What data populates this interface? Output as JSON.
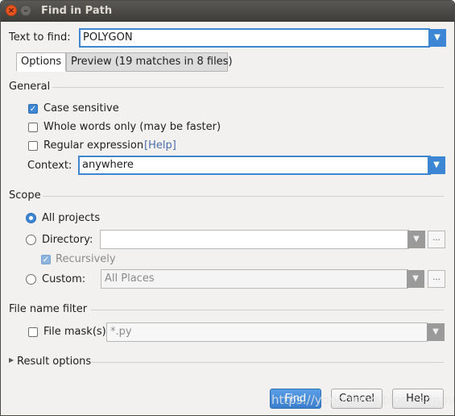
{
  "window": {
    "title": "Find in Path",
    "close_glyph": "×",
    "min_glyph": "–"
  },
  "text_to_find": {
    "label": "Text to find:",
    "value": "POLYGON"
  },
  "tabs": [
    {
      "label": "Options",
      "active": true
    },
    {
      "label": "Preview (19 matches in 8 files)",
      "active": false
    }
  ],
  "general": {
    "title": "General",
    "case_sensitive": {
      "label": "Case sensitive",
      "checked": true
    },
    "whole_words": {
      "label": "Whole words only (may be faster)",
      "checked": false
    },
    "regex": {
      "label": "Regular expression",
      "help": "[Help]",
      "checked": false
    },
    "context": {
      "label": "Context:",
      "value": "anywhere"
    }
  },
  "scope": {
    "title": "Scope",
    "all_projects": {
      "label": "All projects",
      "selected": true
    },
    "directory": {
      "label": "Directory:",
      "value": "",
      "selected": false
    },
    "recursively": {
      "label": "Recursively",
      "checked": true,
      "enabled": false
    },
    "custom": {
      "label": "Custom:",
      "value": "All Places",
      "selected": false
    },
    "browse_label": "..."
  },
  "file_filter": {
    "title": "File name filter",
    "file_mask": {
      "label": "File mask(s)",
      "value": "*.py",
      "checked": false
    }
  },
  "result_options": {
    "label": "Result options"
  },
  "buttons": {
    "find": "Find",
    "cancel": "Cancel",
    "help": "Help"
  },
  "watermark": "https://yongqiang.blog.csdn.net",
  "colors": {
    "accent": "#3d86d4",
    "title_bar": "#3d3c38",
    "close": "#e95420"
  }
}
